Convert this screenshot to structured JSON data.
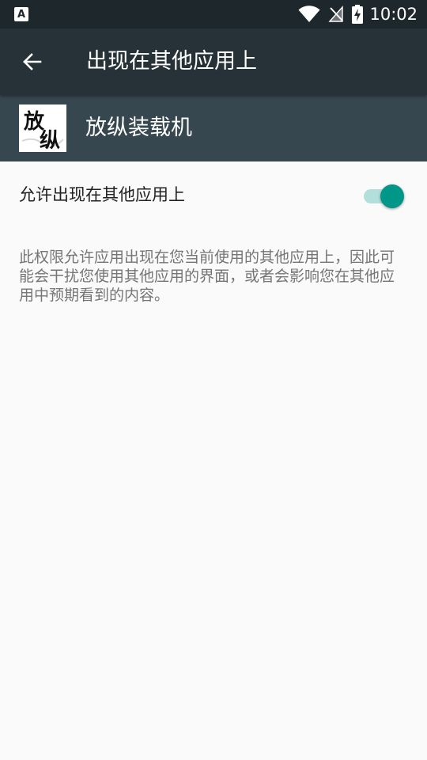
{
  "status_bar": {
    "notification_icon": "text-a-icon",
    "notification_glyph": "A",
    "wifi_icon": "wifi-icon",
    "signal_icon": "no-signal-icon",
    "battery_icon": "battery-charging-icon",
    "time": "10:02"
  },
  "toolbar": {
    "back_icon": "arrow-back-icon",
    "title": "出现在其他应用上"
  },
  "app": {
    "name": "放纵装载机",
    "icon_chars": [
      "放",
      "纵"
    ]
  },
  "setting": {
    "label": "允许出现在其他应用上",
    "enabled": true
  },
  "description": "此权限允许应用出现在您当前使用的其他应用上，因此可能会干扰您使用其他应用的界面，或者会影响您在其他应用中预期看到的内容。",
  "colors": {
    "status_bar": "#1e272b",
    "toolbar": "#263238",
    "app_header": "#37474f",
    "accent": "#009688",
    "accent_track": "#b2dfdb",
    "background": "#fafafa"
  }
}
